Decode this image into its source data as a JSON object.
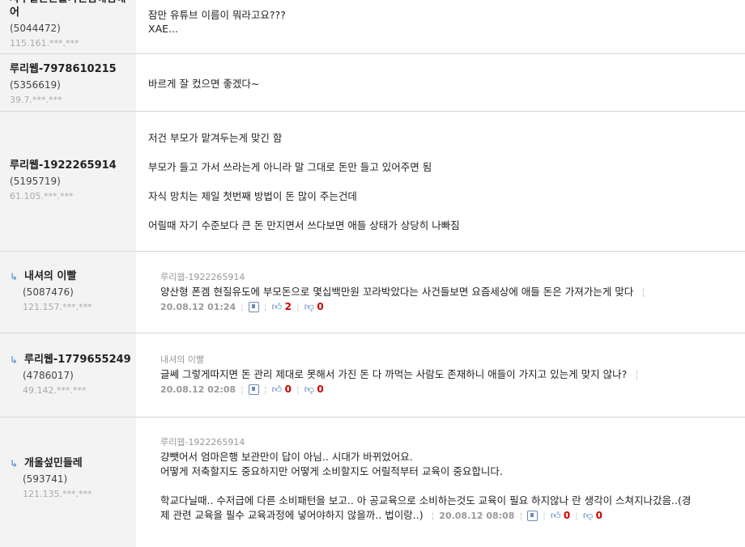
{
  "comments": [
    {
      "nick": "사우랄은은을가진팀해임해어",
      "uid": "(5044472)",
      "ip": "115.161.***.***",
      "lines": [
        "잠만 유튜브 이름이 뭐라고요???",
        "XAE..."
      ]
    },
    {
      "nick": "루리웹-7978610215",
      "uid": "(5356619)",
      "ip": "39.7.***.***",
      "lines": [
        "바르게 잘 컸으면 좋겠다~"
      ]
    },
    {
      "nick": "루리웹-1922265914",
      "uid": "(5195719)",
      "ip": "61.105.***.***",
      "lines": [
        "저건 부모가 맡겨두는게 맞긴 함",
        "부모가 들고 가서 쓰라는게 아니라 말 그대로 돈만 들고 있어주면 됨",
        "자식 망치는 제일 첫번째 방법이 돈 많이 주는건데",
        "어릴때 자기 수준보다 큰 돈 만지면서 쓰다보면 애들 상태가 상당히 나빠짐"
      ]
    }
  ],
  "replies": [
    {
      "nick": "내셔의 이빨",
      "uid": "(5087476)",
      "ip": "121.157.***.***",
      "reply_to": "루리웹-1922265914",
      "text": "양산형 폰겜 현질유도에 부모돈으로 몇십백만원 꼬라박았다는 사건들보면 요즘세상에 애들 돈은 가져가는게 맞다",
      "date": "20.08.12 01:24",
      "up": "2",
      "down": "0"
    },
    {
      "nick": "루리웹-1779655249",
      "uid": "(4786017)",
      "ip": "49.142.***.***",
      "reply_to": "내셔의 이빨",
      "text": "글쎄 그렇게따지면 돈 관리 제대로 못해서 가진 돈 다 까먹는 사람도 존재하니 애들이 가지고 있는게 맞지 않나?",
      "date": "20.08.12 02:08",
      "up": "0",
      "down": "0"
    },
    {
      "nick": "개울섶민들레",
      "uid": "(593741)",
      "ip": "121.135.***.***",
      "reply_to": "루리웹-1922265914",
      "lines": [
        "걍뺏어서 엄마은행 보관만이 답이 아님.. 시대가 바뀌었어요.",
        "어떻게 저축할지도 중요하지만 어떻게 소비할지도 어릴적부터 교육이 중요합니다.",
        "",
        "학교다닐때.. 수저급에 다른 소비패턴을 보고.. 아 공교육으로 소비하는것도 교육이 필요 하지않나 란 생각이 스쳐지나갔음..(경",
        "제 관련 교육을 필수 교육과정에 넣어야하지 않을까.. 법이랑..)"
      ],
      "date": "20.08.12 08:08",
      "up": "0",
      "down": "0"
    }
  ]
}
